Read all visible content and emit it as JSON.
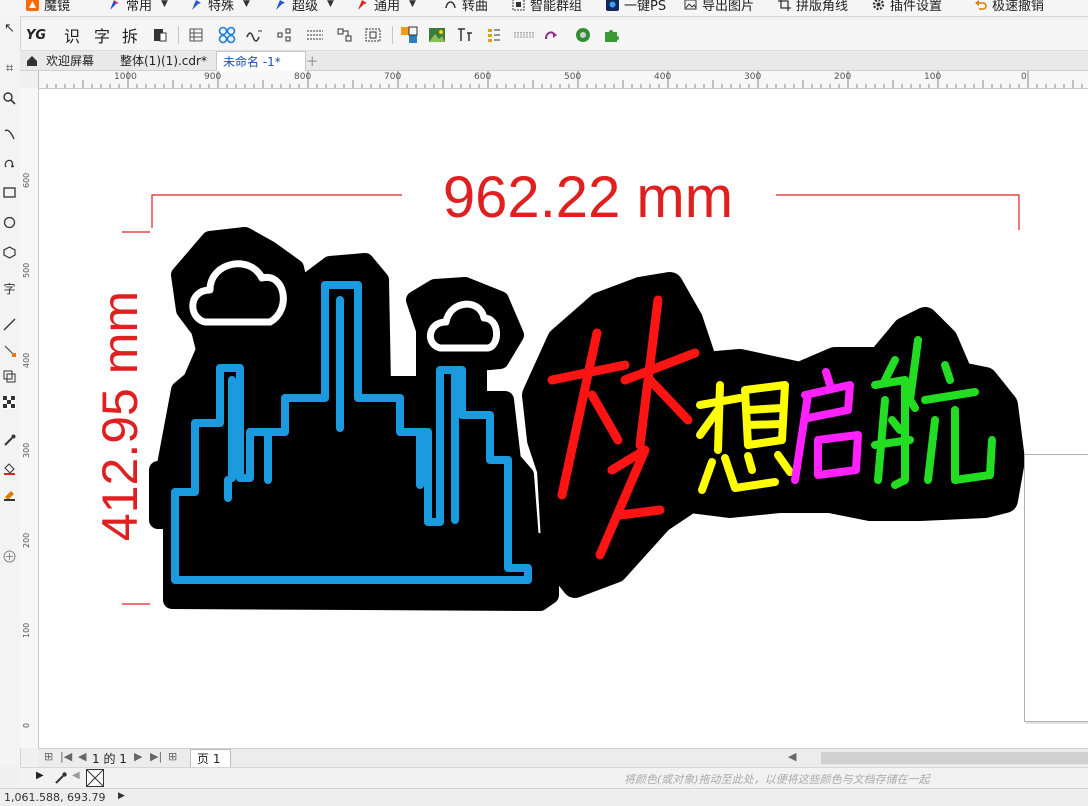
{
  "menubar": {
    "items": [
      {
        "label": "魔镜",
        "icon": "fox-logo-icon",
        "has_dropdown": false
      },
      {
        "label": "常用",
        "icon": "pen-nib-icon",
        "has_dropdown": true
      },
      {
        "label": "特殊",
        "icon": "pen-nib-icon",
        "has_dropdown": true
      },
      {
        "label": "超级",
        "icon": "pen-nib-icon",
        "has_dropdown": true
      },
      {
        "label": "通用",
        "icon": "pen-nib-icon",
        "has_dropdown": true
      },
      {
        "label": "转曲",
        "icon": "curve-icon",
        "has_dropdown": false
      },
      {
        "label": "智能群组",
        "icon": "group-icon",
        "has_dropdown": false
      },
      {
        "label": "一键PS",
        "icon": "ps-icon",
        "has_dropdown": false
      },
      {
        "label": "导出图片",
        "icon": "image-icon",
        "has_dropdown": false
      },
      {
        "label": "拼版角线",
        "icon": "crop-marks-icon",
        "has_dropdown": false
      },
      {
        "label": "插件设置",
        "icon": "gear-icon",
        "has_dropdown": false
      },
      {
        "label": "极速撤销",
        "icon": "undo-icon",
        "has_dropdown": false
      }
    ]
  },
  "toolbar": {
    "yg": "YG",
    "shi": "识",
    "zi": "字",
    "chai": "拆"
  },
  "tabs": [
    {
      "label": "欢迎屏幕",
      "icon": "home-icon"
    },
    {
      "label": "整体(1)(1).cdr*"
    },
    {
      "label": "未命名 -1*"
    }
  ],
  "ruler": {
    "h_labels": [
      "1000",
      "900",
      "800",
      "700",
      "600",
      "500",
      "400",
      "300",
      "200",
      "100",
      "0"
    ],
    "v_labels": [
      "600",
      "500",
      "400",
      "300",
      "200",
      "100",
      "0"
    ]
  },
  "artwork": {
    "width_dim": "962.22 mm",
    "height_dim": "412.95 mm",
    "title_chars": [
      {
        "char": "梦",
        "color": "#ff1414"
      },
      {
        "char": "想",
        "color": "#ffff00"
      },
      {
        "char": "启",
        "color": "#ff22ff"
      },
      {
        "char": "航",
        "color": "#22dd22"
      }
    ],
    "city_color": "#1a9be0",
    "dim_color": "#e02020"
  },
  "pagenav": {
    "page_of": "1 的 1",
    "page_tab": "页 1"
  },
  "status": {
    "hint": "将颜色(或对象)拖动至此处，以便将这些颜色与文档存储在一起",
    "coords": "1,061.588, 693.79"
  }
}
